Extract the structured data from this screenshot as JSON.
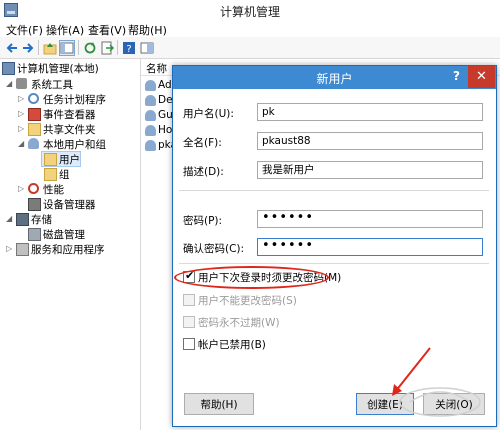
{
  "window": {
    "title": "计算机管理"
  },
  "menu": [
    "文件(F)",
    "操作(A)",
    "查看(V)",
    "帮助(H)"
  ],
  "tree": [
    {
      "label": "计算机管理(本地)",
      "icon": "computer-icon",
      "expander": ""
    },
    {
      "label": "系统工具",
      "icon": "tools-icon",
      "expander": "◢"
    },
    {
      "label": "任务计划程序",
      "icon": "clock-icon",
      "expander": "▷"
    },
    {
      "label": "事件查看器",
      "icon": "event-icon",
      "expander": "▷"
    },
    {
      "label": "共享文件夹",
      "icon": "folder-icon",
      "expander": "▷"
    },
    {
      "label": "本地用户和组",
      "icon": "users-icon",
      "expander": "◢"
    },
    {
      "label": "用户",
      "icon": "folder-icon",
      "expander": ""
    },
    {
      "label": "组",
      "icon": "folder-icon",
      "expander": ""
    },
    {
      "label": "性能",
      "icon": "performance-icon",
      "expander": "▷"
    },
    {
      "label": "设备管理器",
      "icon": "device-icon",
      "expander": ""
    },
    {
      "label": "存储",
      "icon": "storage-icon",
      "expander": "◢"
    },
    {
      "label": "磁盘管理",
      "icon": "disk-icon",
      "expander": ""
    },
    {
      "label": "服务和应用程序",
      "icon": "services-icon",
      "expander": "▷"
    }
  ],
  "list": {
    "header": "名称",
    "items": [
      "Adr",
      "Def",
      "Gue",
      "Hor",
      "pka"
    ]
  },
  "dialog": {
    "title": "新用户",
    "help": "?",
    "close": "✕",
    "username_label": "用户名(U):",
    "username": "pk",
    "fullname_label": "全名(F):",
    "fullname": "pkaust88",
    "desc_label": "描述(D):",
    "desc": "我是新用户",
    "password_label": "密码(P):",
    "password": "••••••",
    "confirm_label": "确认密码(C):",
    "confirm": "••••••",
    "options": [
      {
        "label": "用户下次登录时须更改密码(M)",
        "checked": true,
        "enabled": true
      },
      {
        "label": "用户不能更改密码(S)",
        "checked": false,
        "enabled": false
      },
      {
        "label": "密码永不过期(W)",
        "checked": false,
        "enabled": false
      },
      {
        "label": "帐户已禁用(B)",
        "checked": false,
        "enabled": true
      }
    ],
    "help_button": "帮助(H)",
    "create_button": "创建(E)",
    "close_button": "关闭(O)"
  },
  "colors": {
    "dialog_title_bar": "#3d8ad3",
    "close_button": "#c7392b",
    "annotation": "#e0261b"
  }
}
